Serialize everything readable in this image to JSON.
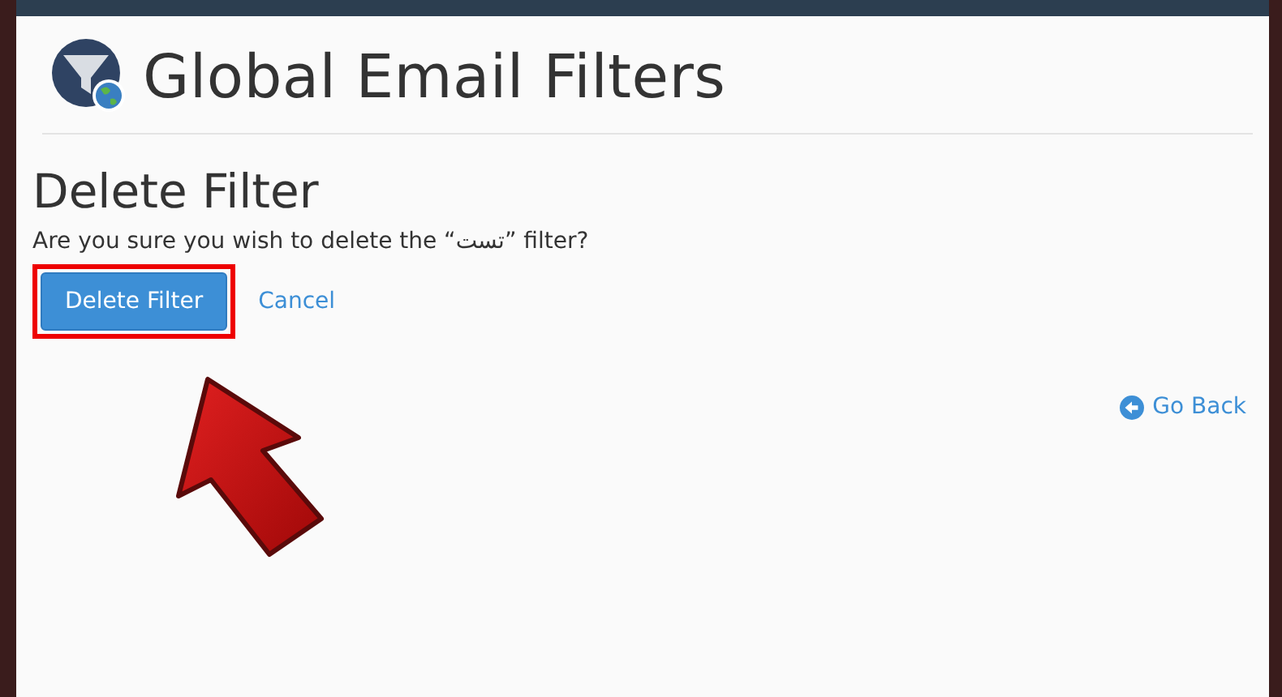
{
  "header": {
    "title": "Global Email Filters"
  },
  "dialog": {
    "heading": "Delete Filter",
    "message": "Are you sure you wish to delete the “تست” filter?",
    "confirm_button": "Delete Filter",
    "cancel_link": "Cancel"
  },
  "go_back_link": "Go Back"
}
